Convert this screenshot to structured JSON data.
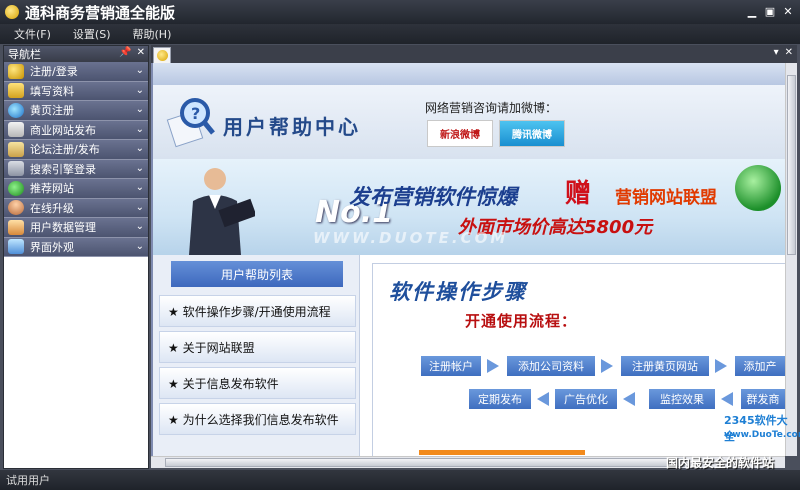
{
  "window": {
    "title": "通科商务营销通全能版",
    "controls": [
      "✖",
      "▪",
      "▪"
    ]
  },
  "menu": [
    {
      "label": "文件(F)"
    },
    {
      "label": "设置(S)"
    },
    {
      "label": "帮助(H)"
    }
  ],
  "sidebar": {
    "header": "导航栏",
    "items": [
      {
        "label": "注册/登录",
        "icon": "key-icon"
      },
      {
        "label": "填写资料",
        "icon": "folder-icon"
      },
      {
        "label": "黄页注册",
        "icon": "globe-icon"
      },
      {
        "label": "商业网站发布",
        "icon": "book-icon"
      },
      {
        "label": "论坛注册/发布",
        "icon": "forum-icon"
      },
      {
        "label": "搜索引擎登录",
        "icon": "search-engine-icon"
      },
      {
        "label": "推荐网站",
        "icon": "check-icon"
      },
      {
        "label": "在线升级",
        "icon": "person-icon"
      },
      {
        "label": "用户数据管理",
        "icon": "data-icon"
      },
      {
        "label": "界面外观",
        "icon": "monitor-icon"
      }
    ]
  },
  "header": {
    "title": "用户帮助中心",
    "weibo_label": "网络营销咨询请加微博：",
    "sina_label": "新浪微博",
    "tencent_label": "腾讯微博"
  },
  "banner": {
    "no1": "No.1",
    "line1": "发布营销软件惊爆",
    "zeng": "赠",
    "line2": "营销网站联盟",
    "line3": "外面市场价高达5800元",
    "watermark": "WWW.DUOTE.COM"
  },
  "help_list": {
    "header": "用户帮助列表",
    "items": [
      "★ 软件操作步骤/开通使用流程",
      "★ 关于网站联盟",
      "★ 关于信息发布软件",
      "★ 为什么选择我们信息发布软件"
    ]
  },
  "steps": {
    "title": "软件操作步骤",
    "subtitle": "开通使用流程：",
    "row1": [
      "注册帐户",
      "添加公司资料",
      "注册黄页网站",
      "添加产"
    ],
    "row2": [
      "定期发布",
      "广告优化",
      "监控效果",
      "群发商"
    ]
  },
  "watermark": {
    "logo": "2345软件大全",
    "site": "www.DuoTe.com",
    "slogan": "国内最安全的软件站"
  },
  "status": {
    "text": "试用用户"
  }
}
